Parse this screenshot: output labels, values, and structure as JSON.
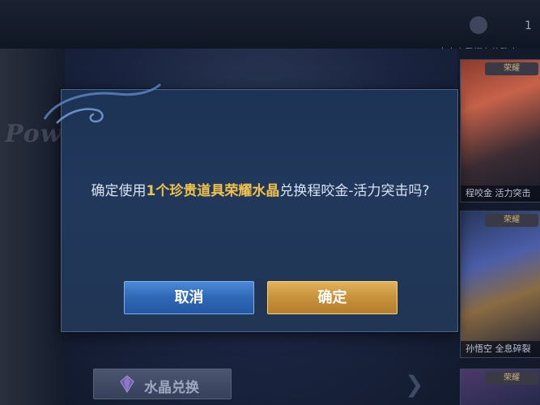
{
  "background": {
    "left_poster_text": "Pow",
    "top_right_number": "1",
    "top_right_hint": "点击查看拥有的确定",
    "cards": [
      {
        "tag": "荣耀",
        "caption": "程咬金 活力突击"
      },
      {
        "tag": "荣耀",
        "caption": "孙悟空 全息碎裂"
      },
      {
        "tag": "荣耀",
        "caption": ""
      }
    ],
    "exchange_button_label": "水晶兑换"
  },
  "dialog": {
    "message_prefix": "确定使用",
    "message_highlight": "1个珍贵道具荣耀水晶",
    "message_suffix": "兑换程咬金-活力突击吗?",
    "cancel_label": "取消",
    "confirm_label": "确定"
  },
  "colors": {
    "highlight": "#f0c24a",
    "cancel_button": "#2f67b6",
    "confirm_button": "#c8913c",
    "dialog_bg": "#1f3558"
  }
}
